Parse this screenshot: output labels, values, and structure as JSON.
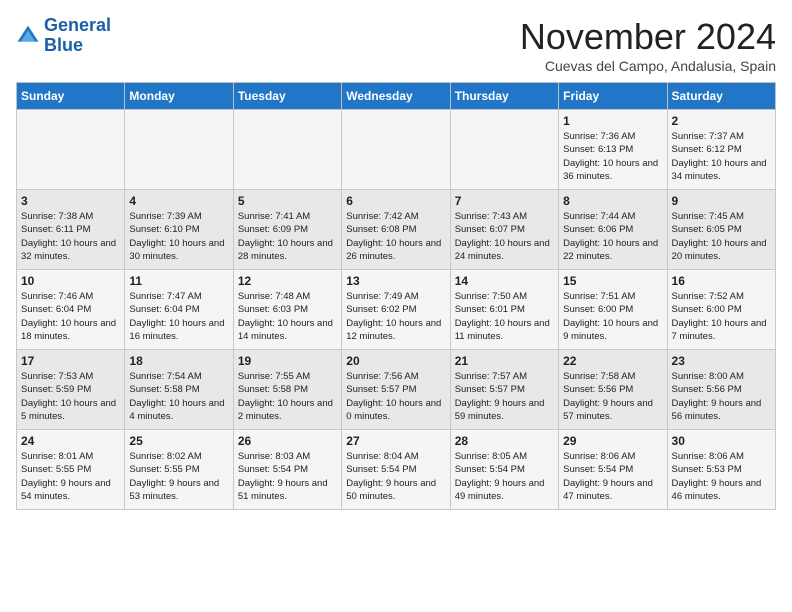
{
  "logo": {
    "line1": "General",
    "line2": "Blue"
  },
  "title": "November 2024",
  "location": "Cuevas del Campo, Andalusia, Spain",
  "days_of_week": [
    "Sunday",
    "Monday",
    "Tuesday",
    "Wednesday",
    "Thursday",
    "Friday",
    "Saturday"
  ],
  "weeks": [
    [
      {
        "day": "",
        "info": ""
      },
      {
        "day": "",
        "info": ""
      },
      {
        "day": "",
        "info": ""
      },
      {
        "day": "",
        "info": ""
      },
      {
        "day": "",
        "info": ""
      },
      {
        "day": "1",
        "info": "Sunrise: 7:36 AM\nSunset: 6:13 PM\nDaylight: 10 hours and 36 minutes."
      },
      {
        "day": "2",
        "info": "Sunrise: 7:37 AM\nSunset: 6:12 PM\nDaylight: 10 hours and 34 minutes."
      }
    ],
    [
      {
        "day": "3",
        "info": "Sunrise: 7:38 AM\nSunset: 6:11 PM\nDaylight: 10 hours and 32 minutes."
      },
      {
        "day": "4",
        "info": "Sunrise: 7:39 AM\nSunset: 6:10 PM\nDaylight: 10 hours and 30 minutes."
      },
      {
        "day": "5",
        "info": "Sunrise: 7:41 AM\nSunset: 6:09 PM\nDaylight: 10 hours and 28 minutes."
      },
      {
        "day": "6",
        "info": "Sunrise: 7:42 AM\nSunset: 6:08 PM\nDaylight: 10 hours and 26 minutes."
      },
      {
        "day": "7",
        "info": "Sunrise: 7:43 AM\nSunset: 6:07 PM\nDaylight: 10 hours and 24 minutes."
      },
      {
        "day": "8",
        "info": "Sunrise: 7:44 AM\nSunset: 6:06 PM\nDaylight: 10 hours and 22 minutes."
      },
      {
        "day": "9",
        "info": "Sunrise: 7:45 AM\nSunset: 6:05 PM\nDaylight: 10 hours and 20 minutes."
      }
    ],
    [
      {
        "day": "10",
        "info": "Sunrise: 7:46 AM\nSunset: 6:04 PM\nDaylight: 10 hours and 18 minutes."
      },
      {
        "day": "11",
        "info": "Sunrise: 7:47 AM\nSunset: 6:04 PM\nDaylight: 10 hours and 16 minutes."
      },
      {
        "day": "12",
        "info": "Sunrise: 7:48 AM\nSunset: 6:03 PM\nDaylight: 10 hours and 14 minutes."
      },
      {
        "day": "13",
        "info": "Sunrise: 7:49 AM\nSunset: 6:02 PM\nDaylight: 10 hours and 12 minutes."
      },
      {
        "day": "14",
        "info": "Sunrise: 7:50 AM\nSunset: 6:01 PM\nDaylight: 10 hours and 11 minutes."
      },
      {
        "day": "15",
        "info": "Sunrise: 7:51 AM\nSunset: 6:00 PM\nDaylight: 10 hours and 9 minutes."
      },
      {
        "day": "16",
        "info": "Sunrise: 7:52 AM\nSunset: 6:00 PM\nDaylight: 10 hours and 7 minutes."
      }
    ],
    [
      {
        "day": "17",
        "info": "Sunrise: 7:53 AM\nSunset: 5:59 PM\nDaylight: 10 hours and 5 minutes."
      },
      {
        "day": "18",
        "info": "Sunrise: 7:54 AM\nSunset: 5:58 PM\nDaylight: 10 hours and 4 minutes."
      },
      {
        "day": "19",
        "info": "Sunrise: 7:55 AM\nSunset: 5:58 PM\nDaylight: 10 hours and 2 minutes."
      },
      {
        "day": "20",
        "info": "Sunrise: 7:56 AM\nSunset: 5:57 PM\nDaylight: 10 hours and 0 minutes."
      },
      {
        "day": "21",
        "info": "Sunrise: 7:57 AM\nSunset: 5:57 PM\nDaylight: 9 hours and 59 minutes."
      },
      {
        "day": "22",
        "info": "Sunrise: 7:58 AM\nSunset: 5:56 PM\nDaylight: 9 hours and 57 minutes."
      },
      {
        "day": "23",
        "info": "Sunrise: 8:00 AM\nSunset: 5:56 PM\nDaylight: 9 hours and 56 minutes."
      }
    ],
    [
      {
        "day": "24",
        "info": "Sunrise: 8:01 AM\nSunset: 5:55 PM\nDaylight: 9 hours and 54 minutes."
      },
      {
        "day": "25",
        "info": "Sunrise: 8:02 AM\nSunset: 5:55 PM\nDaylight: 9 hours and 53 minutes."
      },
      {
        "day": "26",
        "info": "Sunrise: 8:03 AM\nSunset: 5:54 PM\nDaylight: 9 hours and 51 minutes."
      },
      {
        "day": "27",
        "info": "Sunrise: 8:04 AM\nSunset: 5:54 PM\nDaylight: 9 hours and 50 minutes."
      },
      {
        "day": "28",
        "info": "Sunrise: 8:05 AM\nSunset: 5:54 PM\nDaylight: 9 hours and 49 minutes."
      },
      {
        "day": "29",
        "info": "Sunrise: 8:06 AM\nSunset: 5:54 PM\nDaylight: 9 hours and 47 minutes."
      },
      {
        "day": "30",
        "info": "Sunrise: 8:06 AM\nSunset: 5:53 PM\nDaylight: 9 hours and 46 minutes."
      }
    ]
  ]
}
